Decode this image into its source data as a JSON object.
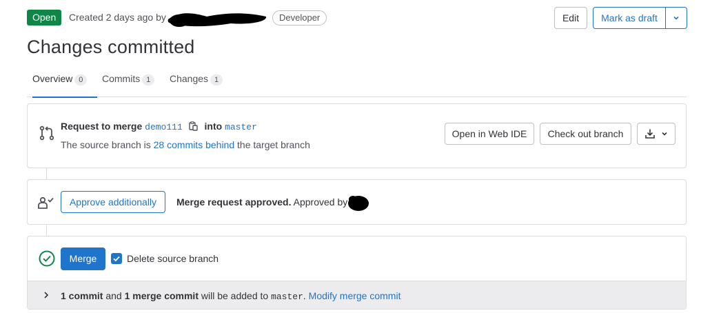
{
  "header": {
    "status_badge": "Open",
    "created_text": "Created 2 days ago by",
    "role_badge": "Developer",
    "edit_label": "Edit",
    "draft_label": "Mark as draft"
  },
  "title": "Changes committed",
  "tabs": [
    {
      "label": "Overview",
      "count": "0"
    },
    {
      "label": "Commits",
      "count": "1"
    },
    {
      "label": "Changes",
      "count": "1"
    }
  ],
  "merge_info": {
    "request_prefix": "Request to merge",
    "source_branch": "demo111",
    "into_text": "into",
    "target_branch": "master",
    "behind_prefix": "The source branch is",
    "behind_link": "28 commits behind",
    "behind_suffix": "the target branch",
    "open_ide_label": "Open in Web IDE",
    "checkout_label": "Check out branch"
  },
  "approval": {
    "approve_label": "Approve additionally",
    "approved_bold": "Merge request approved.",
    "approved_by": "Approved by"
  },
  "merge": {
    "merge_label": "Merge",
    "delete_branch_label": "Delete source branch",
    "footer": {
      "commit_count": "1 commit",
      "and_text": "and",
      "merge_commit": "1 merge commit",
      "added_text": "will be added to",
      "branch": "master",
      "period": ".",
      "modify_link": "Modify merge commit"
    }
  },
  "colors": {
    "accent": "#1f75cb",
    "open_badge": "#108548",
    "success_icon": "#108548"
  }
}
